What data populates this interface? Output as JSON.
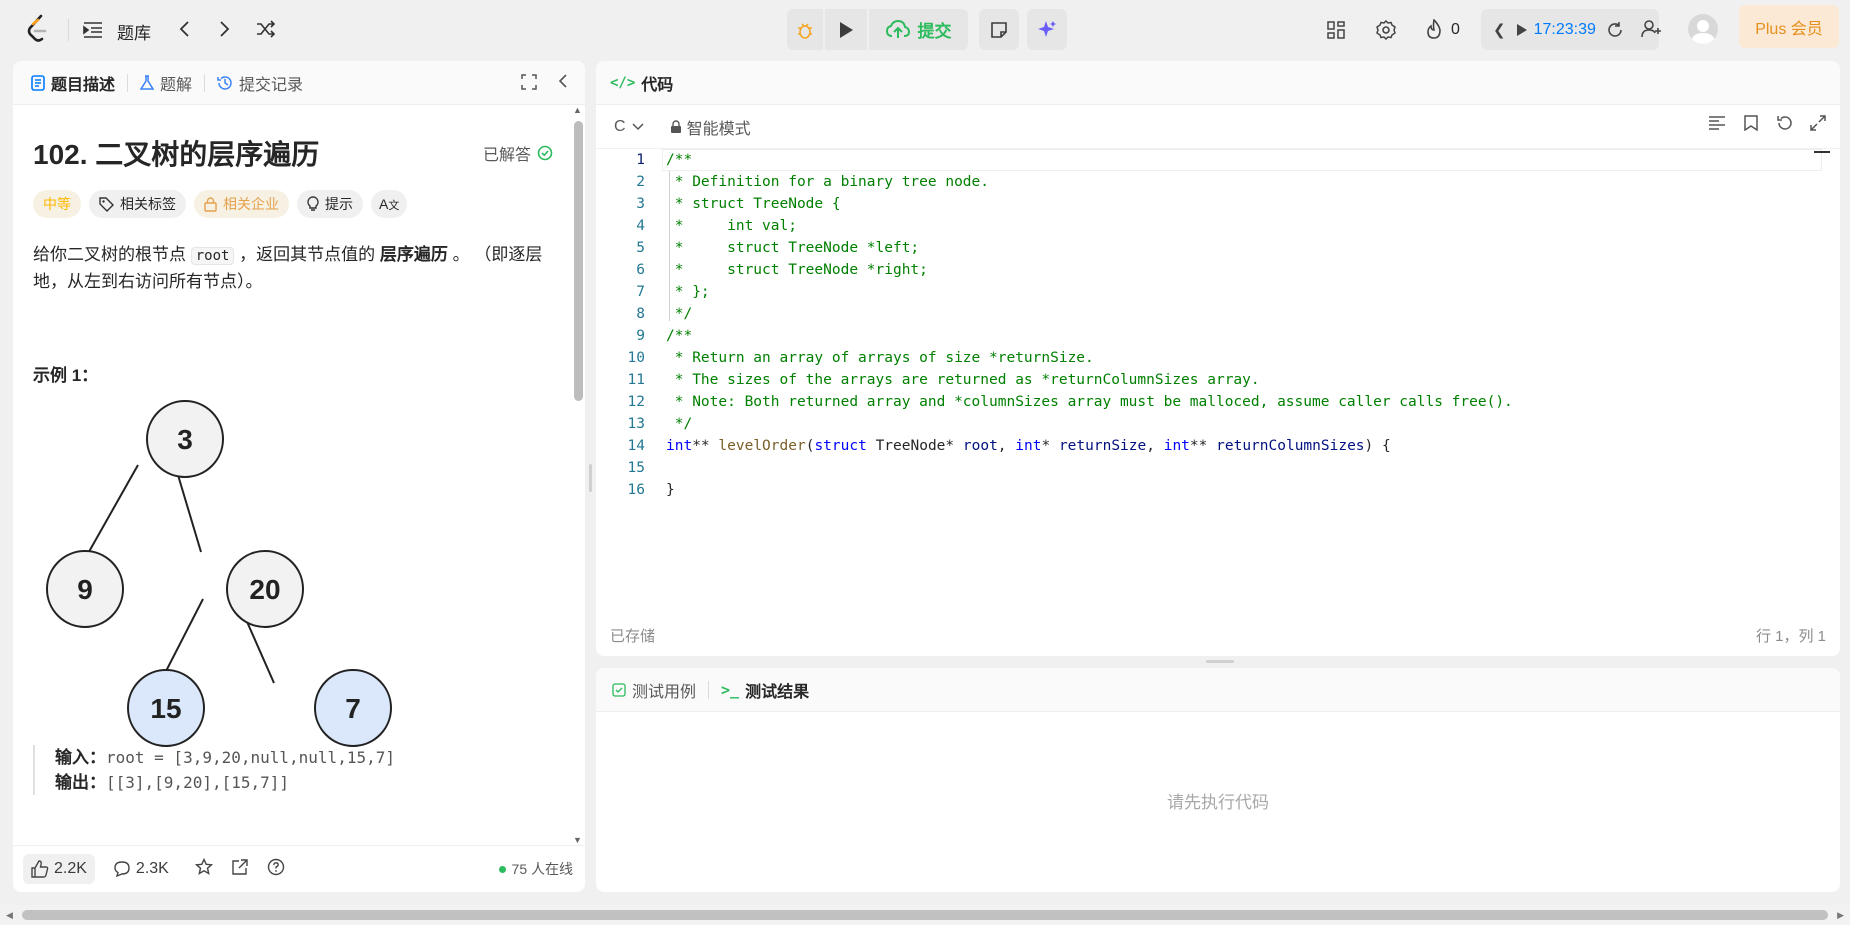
{
  "topbar": {
    "problem_list": "题库",
    "submit": "提交",
    "streak_count": "0",
    "timer": "17:23:39",
    "plus": "Plus 会员"
  },
  "left": {
    "tabs": [
      "题目描述",
      "题解",
      "提交记录"
    ],
    "title": "102. 二叉树的层序遍历",
    "status": "已解答",
    "chips": {
      "difficulty": "中等",
      "tags": "相关标签",
      "companies": "相关企业",
      "hint": "提示"
    },
    "desc_part1": "给你二叉树的根节点 ",
    "desc_code": "root",
    "desc_part2": " ，返回其节点值的 ",
    "desc_bold": "层序遍历",
    "desc_part3": " 。 （即逐层地，从左到右访问所有节点）。",
    "example_title": "示例 1：",
    "tree_nodes": [
      "3",
      "9",
      "20",
      "15",
      "7"
    ],
    "input_label": "输入：",
    "input_value": "root = [3,9,20,null,null,15,7]",
    "output_label": "输出：",
    "output_value": "[[3],[9,20],[15,7]]",
    "likes": "2.2K",
    "comments": "2.3K",
    "online": "75 人在线"
  },
  "code": {
    "tab": "代码",
    "language": "C",
    "mode": "智能模式",
    "saved": "已存储",
    "position": "行 1，列 1"
  },
  "test": {
    "tabs": [
      "测试用例",
      "测试结果"
    ],
    "empty": "请先执行代码"
  },
  "colors": {
    "accent_green": "#2cbb5d",
    "medium_orange": "#ffb800",
    "timer_blue": "#007aff",
    "node_blue": "#dbe8fb"
  }
}
